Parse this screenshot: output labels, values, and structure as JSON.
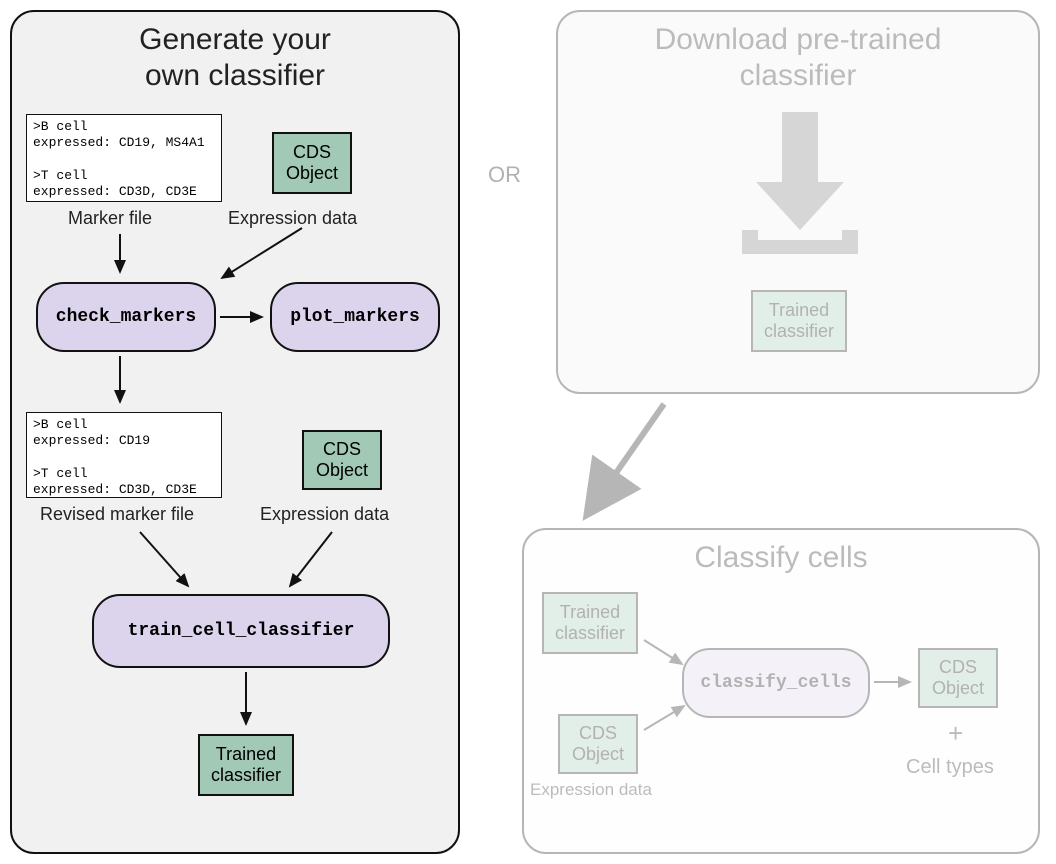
{
  "or_label": "OR",
  "left": {
    "title": "Generate your\nown classifier",
    "marker_file": ">B cell\nexpressed: CD19, MS4A1\n\n>T cell\nexpressed: CD3D, CD3E",
    "marker_file_label": "Marker file",
    "cds_top": "CDS\nObject",
    "expression_top_label": "Expression data",
    "fn_check_markers": "check_markers",
    "fn_plot_markers": "plot_markers",
    "revised_marker_file": ">B cell\nexpressed: CD19\n\n>T cell\nexpressed: CD3D, CD3E",
    "revised_label": "Revised marker file",
    "cds_mid": "CDS\nObject",
    "expression_mid_label": "Expression data",
    "fn_train": "train_cell_classifier",
    "trained_out": "Trained\nclassifier"
  },
  "right_top": {
    "title": "Download pre-trained\nclassifier",
    "trained": "Trained\nclassifier"
  },
  "right_bottom": {
    "title": "Classify cells",
    "trained_in": "Trained\nclassifier",
    "cds_in": "CDS\nObject",
    "expression_label": "Expression data",
    "fn_classify": "classify_cells",
    "cds_out": "CDS\nObject",
    "cell_types": "Cell types",
    "plus": "+"
  }
}
